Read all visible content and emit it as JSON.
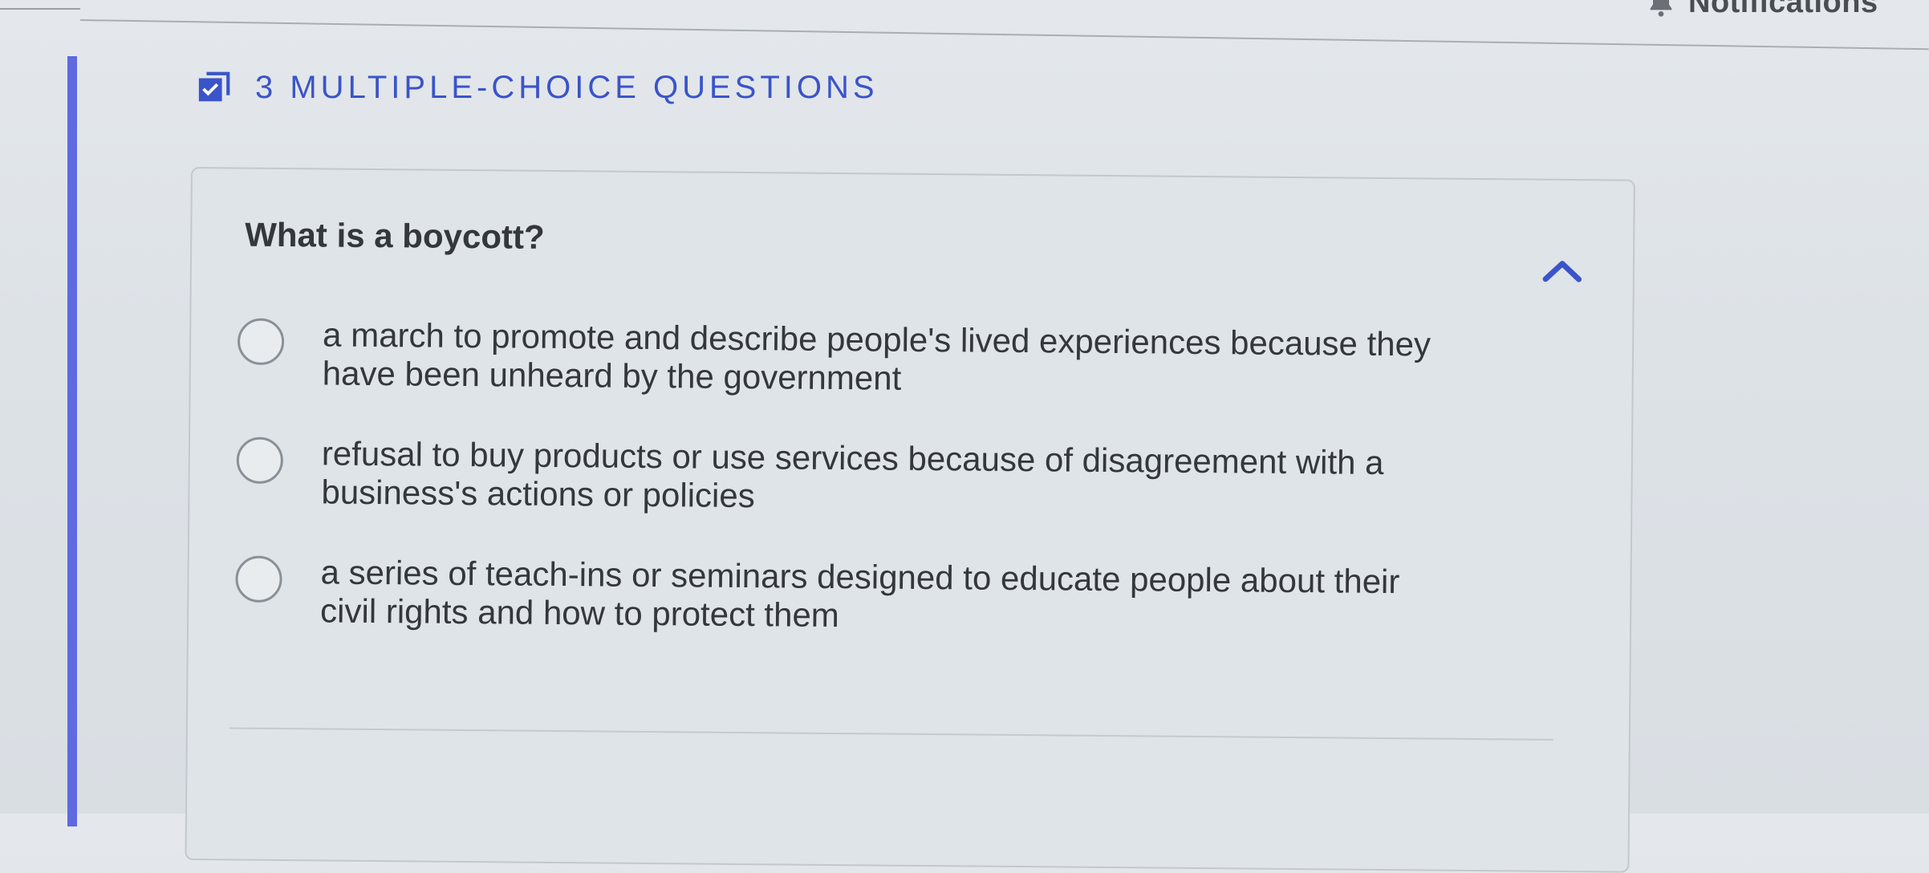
{
  "header": {
    "notifications_label": "Notifications",
    "notifications_icon": "bell-icon"
  },
  "section": {
    "title": "3 MULTIPLE-CHOICE QUESTIONS",
    "icon": "checkbox-arrow-icon",
    "accent_color": "#3a54c9",
    "sidebar_color": "#5f6ae0"
  },
  "question": {
    "prompt": "What is a boycott?",
    "collapse_icon": "chevron-up-icon",
    "options": [
      {
        "text": "a march to promote and describe people's lived experiences because they have been unheard by the government",
        "selected": false
      },
      {
        "text": "refusal to buy products or use services because of disagreement with a business's actions or policies",
        "selected": false
      },
      {
        "text": "a series of teach-ins or seminars designed to educate people about their civil rights and how to protect them",
        "selected": false
      }
    ]
  }
}
